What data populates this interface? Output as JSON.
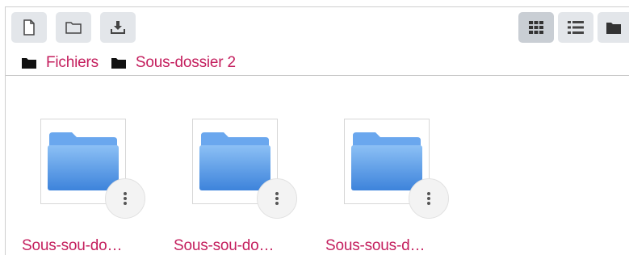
{
  "toolbar": {
    "left_buttons": [
      {
        "icon": "new-file-icon"
      },
      {
        "icon": "new-folder-icon"
      },
      {
        "icon": "download-icon"
      }
    ],
    "view_buttons": [
      {
        "icon": "grid-view-icon",
        "active": true
      },
      {
        "icon": "list-view-icon",
        "active": false
      },
      {
        "icon": "tree-view-icon",
        "active": false
      }
    ]
  },
  "breadcrumb": {
    "items": [
      {
        "label": "Fichiers",
        "icon": "folder-icon"
      },
      {
        "label": "Sous-dossier 2",
        "icon": "folder-icon"
      }
    ]
  },
  "items": [
    {
      "name": "Sous-sou-do…",
      "icon": "folder-icon"
    },
    {
      "name": "Sous-sou-do…",
      "icon": "folder-icon"
    },
    {
      "name": "Sous-sous-d…",
      "icon": "folder-icon"
    }
  ],
  "colors": {
    "link": "#c41f5e",
    "button_bg": "#e3e6ea",
    "button_active_bg": "#c9ced4",
    "folder_blue": "#5b9be6"
  }
}
